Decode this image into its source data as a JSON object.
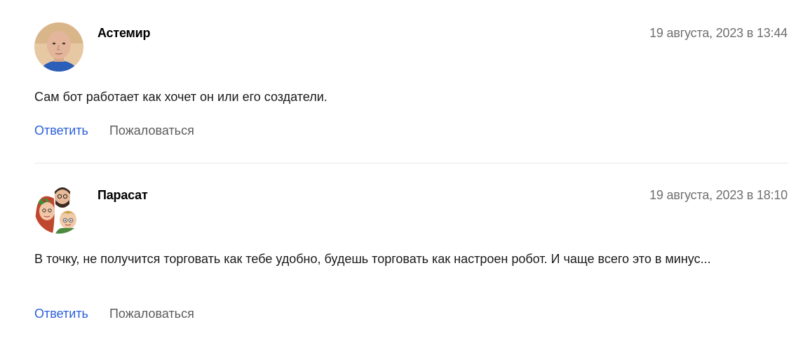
{
  "comments": [
    {
      "author": "Астемир",
      "date": "19 августа, 2023 в 13:44",
      "text": "Сам бот работает как хочет он или его создатели.",
      "reply_label": "Ответить",
      "report_label": "Пожаловаться"
    },
    {
      "author": "Парасат",
      "date": "19 августа, 2023 в 18:10",
      "text": "В точку, не получится торговать как тебе удобно, будешь торговать как настроен робот. И чаще всего это в минус...",
      "reply_label": "Ответить",
      "report_label": "Пожаловаться"
    }
  ],
  "colors": {
    "link": "#2b5fd9",
    "secondary_text": "#6f6f6f",
    "divider": "#e6e8ec"
  }
}
